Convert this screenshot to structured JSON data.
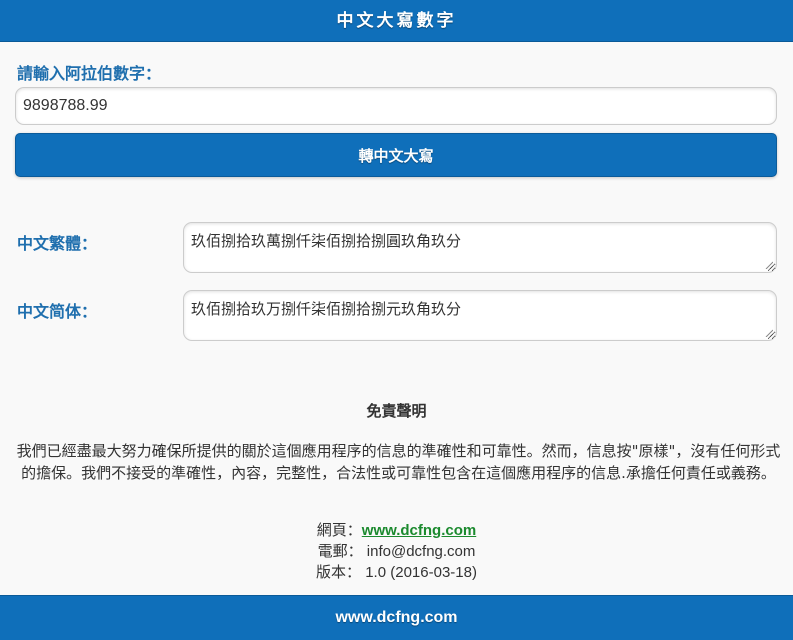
{
  "header": {
    "title": "中文大寫數字"
  },
  "input": {
    "label": "請輸入阿拉伯數字：",
    "value": "9898788.99"
  },
  "convert_button": {
    "label": "轉中文大寫"
  },
  "results": {
    "traditional": {
      "label": "中文繁體：",
      "value": "玖佰捌拾玖萬捌仟柒佰捌拾捌圓玖角玖分"
    },
    "simplified": {
      "label": "中文简体：",
      "value": "玖佰捌拾玖万捌仟柒佰捌拾捌元玖角玖分"
    }
  },
  "disclaimer": {
    "title": "免責聲明",
    "body": "我們已經盡最大努力確保所提供的關於這個應用程序的信息的準確性和可靠性。然而，信息按\"原樣\"，沒有任何形式的擔保。我們不接受的準確性，內容，完整性，合法性或可靠性包含在這個應用程序的信息.承擔任何責任或義務。"
  },
  "contact": {
    "website_label": "網頁：",
    "website": "www.dcfng.com",
    "email_label": "電郵：",
    "email": "info@dcfng.com",
    "version_label": "版本：",
    "version": "1.0 (2016-03-18)"
  },
  "footer": {
    "text": "www.dcfng.com"
  },
  "colors": {
    "primary": "#0f6fba",
    "label": "#1f6fae",
    "link": "#1b8a2e",
    "background": "#f9f9f9"
  }
}
